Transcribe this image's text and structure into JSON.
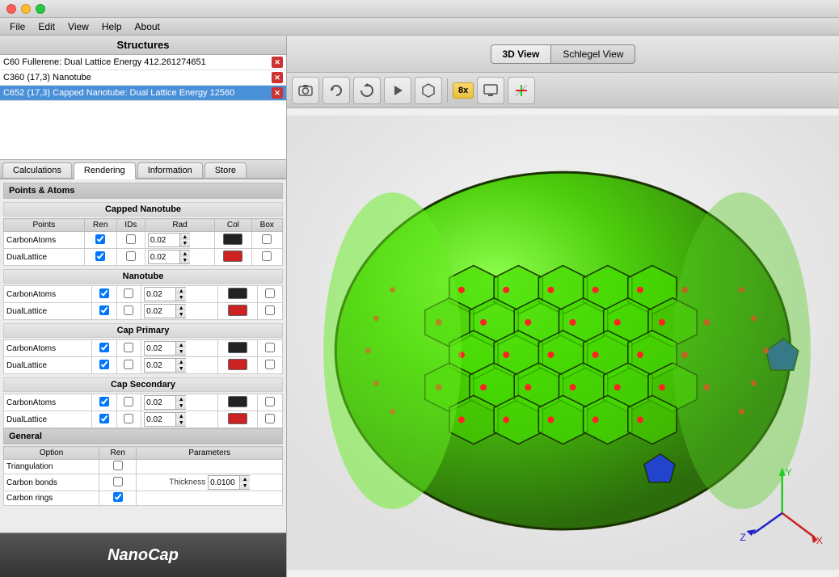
{
  "titlebar": {
    "traffic_lights": [
      "close",
      "minimize",
      "maximize"
    ]
  },
  "menubar": {
    "items": [
      "File",
      "Edit",
      "View",
      "Help",
      "About"
    ]
  },
  "left_panel": {
    "title": "Structures",
    "structures": [
      {
        "label": "C60 Fullerene: Dual Lattice Energy 412.261274651",
        "selected": false
      },
      {
        "label": "C360 (17,3) Nanotube",
        "selected": false
      },
      {
        "label": "C652 (17,3) Capped Nanotube: Dual Lattice Energy 12560",
        "selected": true
      }
    ],
    "tabs": [
      "Calculations",
      "Rendering",
      "Information",
      "Store"
    ],
    "active_tab": "Rendering",
    "sections": {
      "points_atoms": "Points & Atoms",
      "capped_nanotube": "Capped Nanotube",
      "nanotube": "Nanotube",
      "cap_primary": "Cap Primary",
      "cap_secondary": "Cap Secondary",
      "general": "General"
    },
    "table_headers": [
      "Points",
      "Ren",
      "IDs",
      "Rad",
      "Col",
      "Box"
    ],
    "rows": {
      "capped": [
        {
          "name": "CarbonAtoms",
          "ren": true,
          "ids": false,
          "rad": "0.02",
          "col": "black",
          "box": false
        },
        {
          "name": "DualLattice",
          "ren": true,
          "ids": false,
          "rad": "0.02",
          "col": "red",
          "box": false
        }
      ],
      "nanotube": [
        {
          "name": "CarbonAtoms",
          "ren": true,
          "ids": false,
          "rad": "0.02",
          "col": "black",
          "box": false
        },
        {
          "name": "DualLattice",
          "ren": true,
          "ids": false,
          "rad": "0.02",
          "col": "red",
          "box": false
        }
      ],
      "cap_primary": [
        {
          "name": "CarbonAtoms",
          "ren": true,
          "ids": false,
          "rad": "0.02",
          "col": "black",
          "box": false
        },
        {
          "name": "DualLattice",
          "ren": true,
          "ids": false,
          "rad": "0.02",
          "col": "red",
          "box": false
        }
      ],
      "cap_secondary": [
        {
          "name": "CarbonAtoms",
          "ren": true,
          "ids": false,
          "rad": "0.02",
          "col": "black",
          "box": false
        },
        {
          "name": "DualLattice",
          "ren": true,
          "ids": false,
          "rad": "0.02",
          "col": "red",
          "box": false
        }
      ]
    },
    "general": {
      "header_option": "Option",
      "header_ren": "Ren",
      "header_params": "Parameters",
      "rows": [
        {
          "label": "Triangulation",
          "ren": false,
          "params": ""
        },
        {
          "label": "Carbon bonds",
          "ren": false,
          "params": "Thickness 0.0100"
        },
        {
          "label": "Carbon rings",
          "ren": true,
          "params": ""
        }
      ],
      "thickness_label": "Thickness",
      "thickness_value": "0.0100"
    }
  },
  "right_panel": {
    "view_tabs": [
      "3D View",
      "Schlegel View"
    ],
    "active_view": "3D View",
    "toolbar_buttons": [
      {
        "icon": "📷",
        "name": "camera"
      },
      {
        "icon": "↺",
        "name": "rotate"
      },
      {
        "icon": "⟳",
        "name": "refresh"
      },
      {
        "icon": "▶",
        "name": "play"
      },
      {
        "icon": "⬡",
        "name": "hexagon"
      }
    ],
    "zoom_label": "8x",
    "axes": {
      "x_color": "#cc2222",
      "y_color": "#22cc22",
      "z_color": "#2222cc"
    }
  },
  "logo": {
    "text": "NanoCap"
  }
}
